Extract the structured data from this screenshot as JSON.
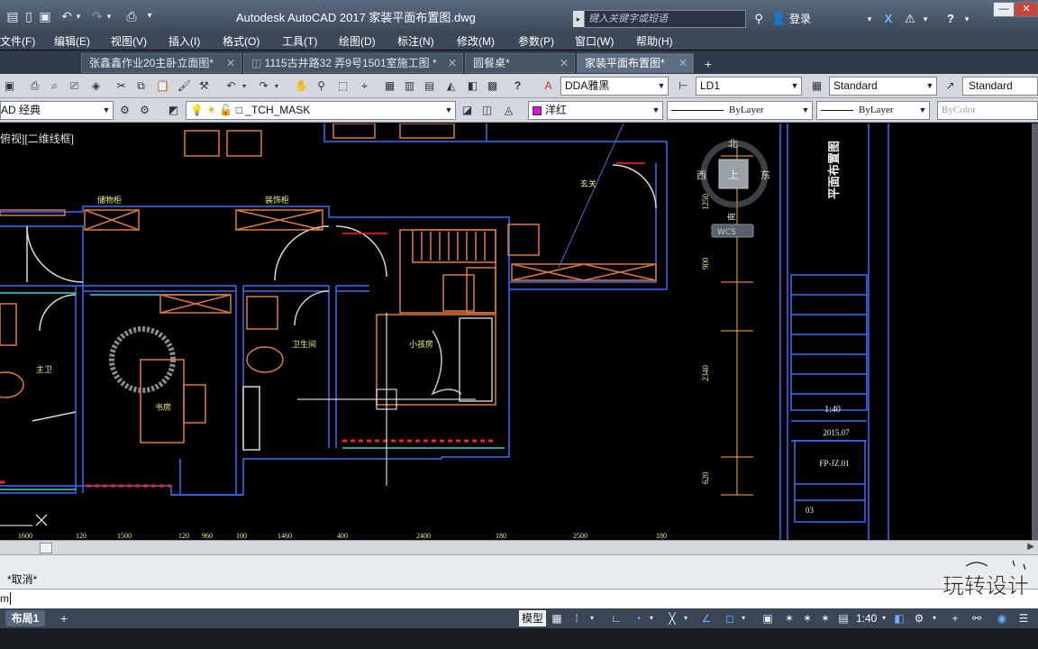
{
  "window": {
    "title": "Autodesk AutoCAD 2017      家装平面布置图.dwg",
    "search_placeholder": "键入关键字或短语",
    "login_label": "登录"
  },
  "menubar": {
    "items": [
      "文件(F)",
      "编辑(E)",
      "视图(V)",
      "插入(I)",
      "格式(O)",
      "工具(T)",
      "绘图(D)",
      "标注(N)",
      "修改(M)",
      "参数(P)",
      "窗口(W)",
      "帮助(H)"
    ]
  },
  "tabs": [
    {
      "label": "张鑫鑫作业20主卧立面图*",
      "active": false
    },
    {
      "label": "1115古井路32 弄9号1501室施工图 *",
      "active": false
    },
    {
      "label": "圆餐桌*",
      "active": false
    },
    {
      "label": "家装平面布置图*",
      "active": true
    }
  ],
  "toolbar1": {
    "text_style": "DDA雅黑",
    "dim_style": "LD1",
    "table_style": "Standard",
    "multileader_style": "Standard"
  },
  "toolbar2": {
    "workspace": "AD 经典",
    "layer": "_TCH_MASK",
    "color": "洋红",
    "linetype": "ByLayer",
    "lineweight": "ByLayer",
    "plotstyle": "ByColor",
    "color_swatch": "#e010e0"
  },
  "drawing": {
    "viewport_label": "俯视][二维线框]",
    "rooms": [
      "储物柜",
      "装饰柜",
      "玄关",
      "主卫",
      "书房",
      "卫生间",
      "小孩房"
    ],
    "viewcube": {
      "north": "北",
      "west": "西",
      "east": "东",
      "face": "上",
      "south_text": "南",
      "wcs": "WCS"
    },
    "dims_right": [
      "1250",
      "900",
      "2340",
      "620"
    ],
    "dims_bottom": [
      "1600",
      "120",
      "1500",
      "120",
      "960",
      "100",
      "1460",
      "400",
      "2400",
      "180",
      "2500",
      "180"
    ],
    "title_block": {
      "title": "平面布置图",
      "scale": "1:40",
      "date": "2015.07",
      "drawing_no": "FP-JZ.01",
      "sheet": "03"
    }
  },
  "command": {
    "last_message": "*取消*",
    "input": "m"
  },
  "statusbar": {
    "layout_tab": "布局1",
    "model_label": "模型",
    "scale": "1:40"
  },
  "watermark": {
    "text": "玩转设计"
  }
}
